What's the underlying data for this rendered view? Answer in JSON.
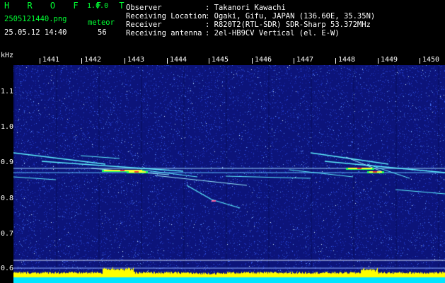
{
  "app": {
    "name": "H R O F F T",
    "version": "1.0.0"
  },
  "capture": {
    "filename": "2505121440.png",
    "mode": "meteor",
    "datetime": "25.05.12 14:40",
    "count": "56"
  },
  "info": [
    {
      "label": "Observer",
      "value": ": Takanori Kawachi"
    },
    {
      "label": "Receiving Location",
      "value": ": Ogaki, Gifu, JAPAN (136.60E, 35.35N)"
    },
    {
      "label": "Receiver",
      "value": ": R820T2(RTL-SDR) SDR-Sharp 53.372MHz"
    },
    {
      "label": "Receiving antenna",
      "value": ": 2el-HB9CV Vertical (el. E-W)"
    }
  ],
  "axes": {
    "freq_unit": "kHz",
    "time_ticks": [
      "1441",
      "1442",
      "1443",
      "1444",
      "1445",
      "1446",
      "1447",
      "1448",
      "1449",
      "1450"
    ],
    "freq_ticks": [
      "1.1",
      "1.0",
      "0.9",
      "0.8",
      "0.7",
      "0.6"
    ]
  },
  "colors": {
    "background": "#000000",
    "noise_blue": "#1a2aa0",
    "header_green": "#00ff33",
    "baseline_yellow": "#ffff00",
    "baseline_cyan": "#00e5ff"
  }
}
